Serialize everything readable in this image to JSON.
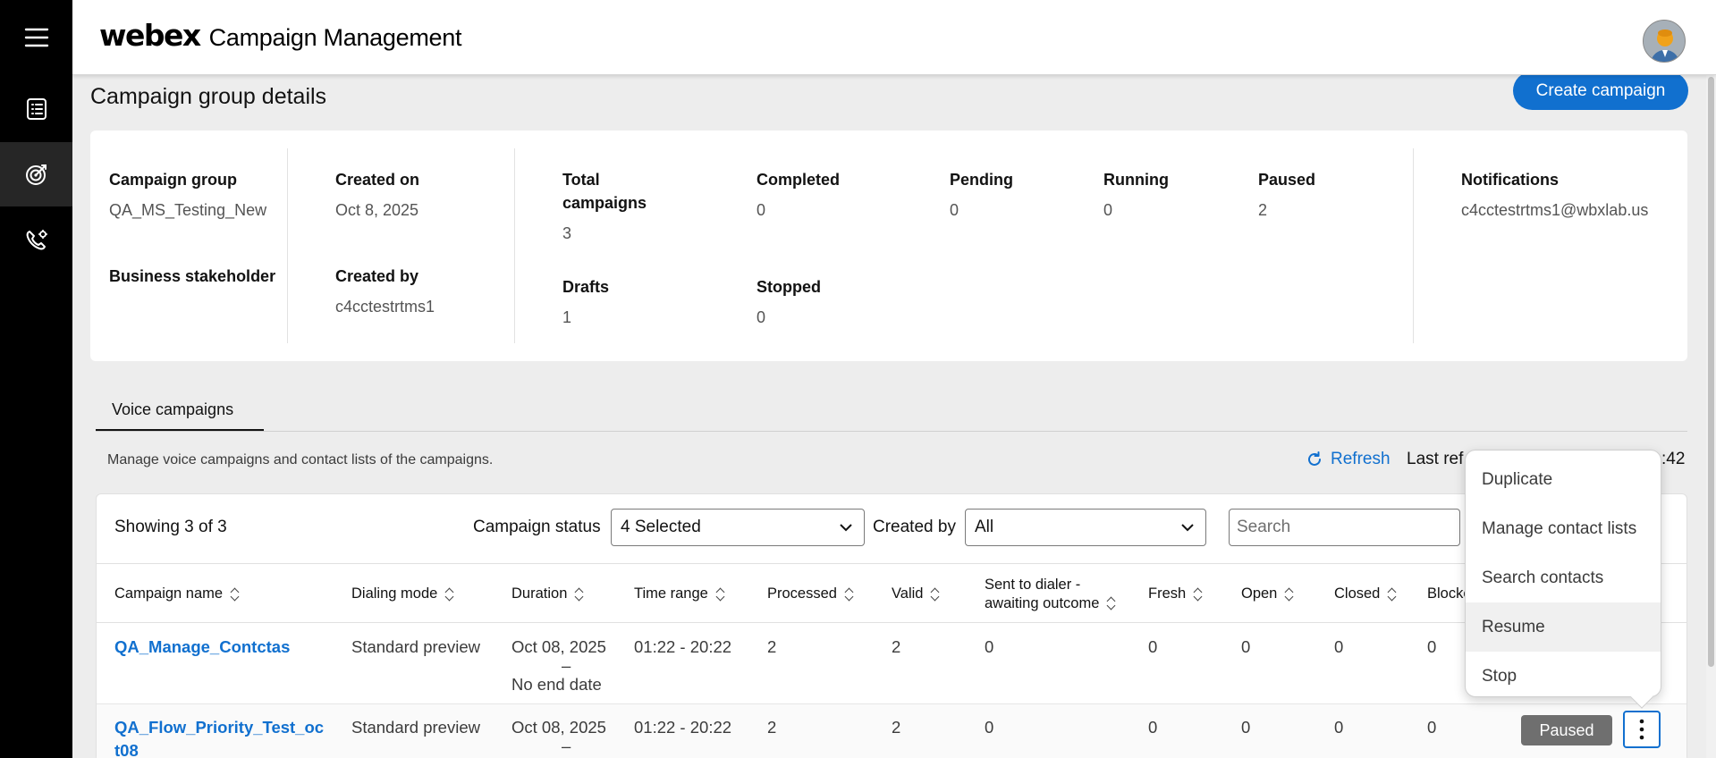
{
  "app": {
    "brand": "webex",
    "title": "Campaign Management"
  },
  "nav": {
    "items": [
      {
        "icon": "menu-icon"
      },
      {
        "icon": "list-icon"
      },
      {
        "icon": "target-icon",
        "active": true
      },
      {
        "icon": "phone-settings-icon"
      }
    ]
  },
  "page": {
    "title": "Campaign group details",
    "create_button": "Create campaign"
  },
  "details": {
    "campaign_group_label": "Campaign group",
    "campaign_group_value": "QA_MS_Testing_New",
    "business_stakeholder_label": "Business stakeholder",
    "created_on_label": "Created on",
    "created_on_value": "Oct 8, 2025",
    "created_by_label": "Created by",
    "created_by_value": "c4cctestrtms1",
    "total_label_1": "Total",
    "total_label_2": "campaigns",
    "total_value": "3",
    "completed_label": "Completed",
    "completed_value": "0",
    "pending_label": "Pending",
    "pending_value": "0",
    "running_label": "Running",
    "running_value": "0",
    "paused_label": "Paused",
    "paused_value": "2",
    "drafts_label": "Drafts",
    "drafts_value": "1",
    "stopped_label": "Stopped",
    "stopped_value": "0",
    "notifications_label": "Notifications",
    "notifications_value": "c4cctestrtms1@wbxlab.us"
  },
  "tabs": {
    "voice": "Voice campaigns"
  },
  "toolbar": {
    "helper": "Manage voice campaigns and contact lists of the campaigns.",
    "refresh": "Refresh",
    "last_refreshed": "Last ref",
    "last_refreshed_tail": ":42"
  },
  "table": {
    "showing": "Showing 3 of 3",
    "filters": {
      "status_label": "Campaign status",
      "status_value": "4 Selected",
      "created_by_label": "Created by",
      "created_by_value": "All",
      "search_placeholder": "Search"
    },
    "columns": [
      "Campaign name",
      "Dialing mode",
      "Duration",
      "Time range",
      "Processed",
      "Valid",
      "Sent to dialer -",
      "awaiting outcome",
      "Fresh",
      "Open",
      "Closed",
      "Blocke"
    ],
    "rows": [
      {
        "name": "QA_Manage_Contctas",
        "mode": "Standard preview",
        "duration_start": "Oct 08, 2025",
        "duration_sep": "–",
        "duration_end": "No end date",
        "time_range": "01:22 - 20:22",
        "processed": "2",
        "valid": "2",
        "sent": "0",
        "fresh": "0",
        "open": "0",
        "closed": "0",
        "blocked": "0"
      },
      {
        "name_1": "QA_Flow_Priority_Test_oc",
        "name_2": "t08",
        "mode": "Standard preview",
        "duration_start": "Oct 08, 2025",
        "duration_sep": "–",
        "time_range": "01:22 - 20:22",
        "processed": "2",
        "valid": "2",
        "sent": "0",
        "fresh": "0",
        "open": "0",
        "closed": "0",
        "blocked": "0",
        "status": "Paused"
      }
    ]
  },
  "menu": {
    "items": [
      "Duplicate",
      "Manage contact lists",
      "Search contacts",
      "Resume",
      "Stop"
    ],
    "hovered": "Resume"
  },
  "colors": {
    "accent": "#1170cf",
    "rail": "#000000",
    "badge": "#6f6f6f"
  }
}
